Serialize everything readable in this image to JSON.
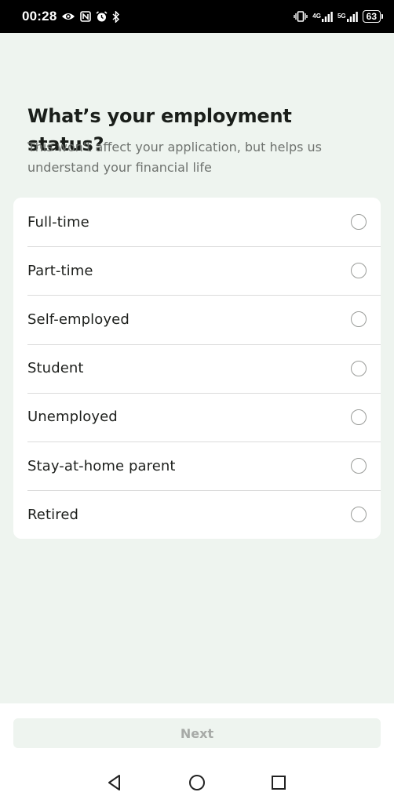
{
  "status_bar": {
    "time": "00:28",
    "left_icons": [
      "eye-icon",
      "nfc-icon",
      "alarm-icon",
      "bluetooth-icon"
    ],
    "right_icons": [
      "vibrate-icon",
      "signal-4g-icon",
      "signal-5g-icon"
    ],
    "net_4g": "4G",
    "net_5g": "5G",
    "battery_level": "63"
  },
  "screen": {
    "title": "What’s your employment status?",
    "subtitle": "This won't affect your application, but helps us understand your financial life"
  },
  "options": [
    {
      "label": "Full-time",
      "selected": false
    },
    {
      "label": "Part-time",
      "selected": false
    },
    {
      "label": "Self-employed",
      "selected": false
    },
    {
      "label": "Student",
      "selected": false
    },
    {
      "label": "Unemployed",
      "selected": false
    },
    {
      "label": "Stay-at-home parent",
      "selected": false
    },
    {
      "label": "Retired",
      "selected": false
    }
  ],
  "footer": {
    "next_label": "Next",
    "next_enabled": false
  },
  "nav": {
    "icons": [
      "back-icon",
      "home-icon",
      "recents-icon"
    ]
  },
  "colors": {
    "background": "#eef4ef",
    "card": "#ffffff",
    "title_text": "#1a1e1a",
    "subtitle_text": "#6f736f",
    "radio_border": "#9a9c99",
    "disabled_button_bg": "#eef4ef",
    "disabled_button_text": "#a7aaa7"
  }
}
